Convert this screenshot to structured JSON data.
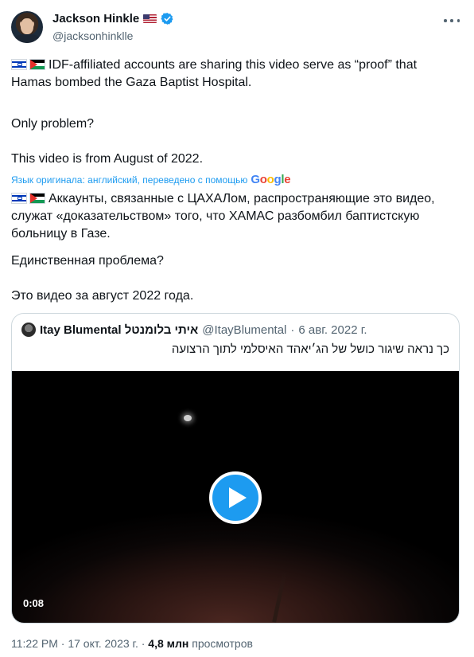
{
  "author": {
    "name": "Jackson Hinkle",
    "handle": "@jacksonhinklle"
  },
  "tweet": {
    "original_lines": [
      "IDF-affiliated accounts are sharing this video serve as “proof” that\nHamas bombed the Gaza Baptist Hospital.",
      "Only problem?",
      "This video is from August of 2022."
    ],
    "translation_note": "Язык оригинала: английский, переведено с помощью",
    "translation_brand": "Google",
    "translated_lines": [
      "Аккаунты, связанные с ЦАХАЛом, распространяющие это видео,\nслужат «доказательством» того, что ХАМАС разбомбил баптистскую\nбольницу в Газе.",
      "Единственная проблема?",
      "Это видео за август 2022 года."
    ]
  },
  "quoted_tweet": {
    "name": "Itay Blumental איתי בלומנטל",
    "handle": "@ItayBlumental",
    "separator": "·",
    "date": "6 авг. 2022 г.",
    "text": "כך נראה שיגור כושל של הג׳יאהד האיסלמי לתוך הרצועה",
    "video_duration": "0:08"
  },
  "footer": {
    "time": "11:22 PM",
    "separator": "·",
    "date": "17 окт. 2023 г.",
    "views_count": "4,8 млн",
    "views_label": "просмотров"
  },
  "icons": [
    "more-icon",
    "verified-icon",
    "us-flag-icon",
    "israel-flag-icon",
    "palestine-flag-icon",
    "play-icon"
  ],
  "colors": {
    "accent": "#1d9bf0",
    "text": "#0f1419",
    "muted": "#536471"
  }
}
